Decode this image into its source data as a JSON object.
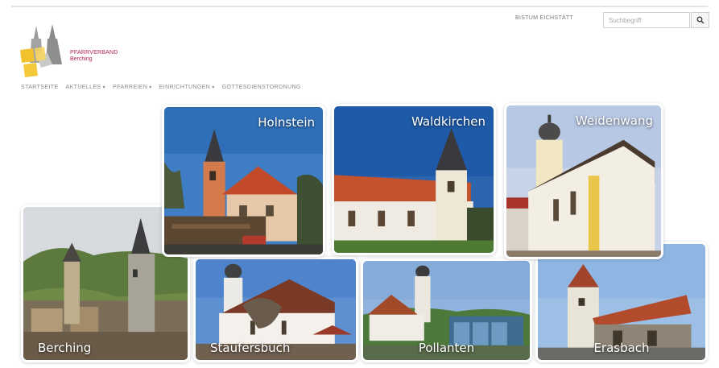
{
  "brand": {
    "line1": "PFARRVERBAND",
    "line2": "Berching"
  },
  "header": {
    "link_label": "BISTUM EICHSTÄTT",
    "search_placeholder": "Suchbegriff",
    "search_icon": "search-icon"
  },
  "nav": [
    {
      "label": "STARTSEITE",
      "has_dropdown": false
    },
    {
      "label": "AKTUELLES",
      "has_dropdown": true
    },
    {
      "label": "PFARREIEN",
      "has_dropdown": true
    },
    {
      "label": "EINRICHTUNGEN",
      "has_dropdown": true
    },
    {
      "label": "GOTTESDIENSTORDNUNG",
      "has_dropdown": false
    }
  ],
  "parishes": {
    "holnstein": "Holnstein",
    "waldkirchen": "Waldkirchen",
    "weidenwang": "Weidenwang",
    "berching": "Berching",
    "staufersbuch": "Staufersbuch",
    "pollanten": "Pollanten",
    "erasbach": "Erasbach"
  },
  "colors": {
    "brand": "#b21f4f",
    "logo_yellow": "#f2c12e",
    "logo_grey": "#8a8a8a"
  }
}
